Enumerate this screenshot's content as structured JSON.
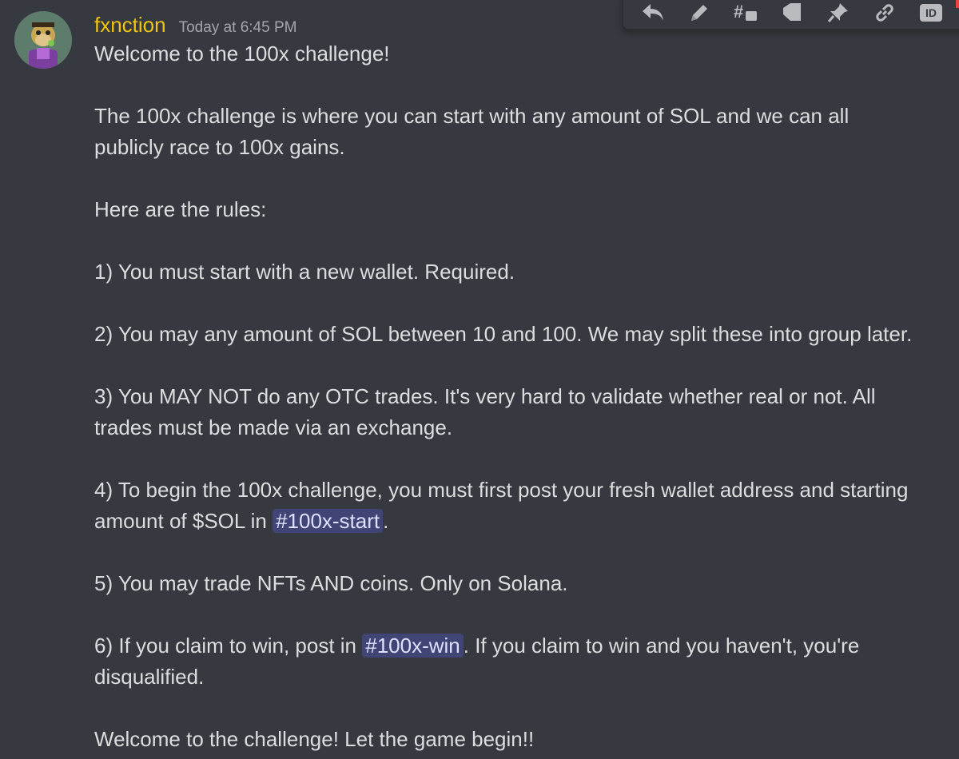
{
  "message": {
    "author": "fxnction",
    "timestamp": "Today at 6:45 PM",
    "content": {
      "p1": "Welcome to the 100x challenge!",
      "p2_line1": "The 100x challenge is where you can start with any amount of SOL and we can all",
      "p2_line2": "publicly race to 100x gains.",
      "p3": "Here are the rules:",
      "rule1": "1) You must start with a new wallet. Required.",
      "rule2": "2) You may any amount of SOL between 10 and 100. We may split these into group later.",
      "rule3_line1": "3) You MAY NOT do any OTC trades. It's very hard to validate whether real or not. All",
      "rule3_line2": "trades must be made via an exchange.",
      "rule4_line1": "4) To begin the 100x challenge, you must first post your fresh wallet address and starting",
      "rule4_line2_pre": "amount of $SOL in ",
      "rule4_mention": "#100x-start",
      "rule4_line2_post": ".",
      "rule5": "5) You may trade NFTs AND coins. Only on Solana.",
      "rule6_line1_pre": "6) If you claim to win, post in ",
      "rule6_mention": "#100x-win",
      "rule6_line1_post": ". If you claim to win and you haven't, you're",
      "rule6_line2": "disqualified.",
      "closing": "Welcome to the challenge! Let the game begin!!"
    }
  },
  "toolbar": {
    "buttons": [
      "reply-icon",
      "edit-icon",
      "create-thread-icon",
      "tag-icon",
      "pin-icon",
      "copy-link-icon",
      "copy-id-icon"
    ],
    "id_badge_label": "ID"
  },
  "colors": {
    "background": "#36393f",
    "username": "#f1c40f",
    "text": "#dcddde",
    "timestamp": "#a3a6aa",
    "mention_text": "#dee0fc"
  }
}
